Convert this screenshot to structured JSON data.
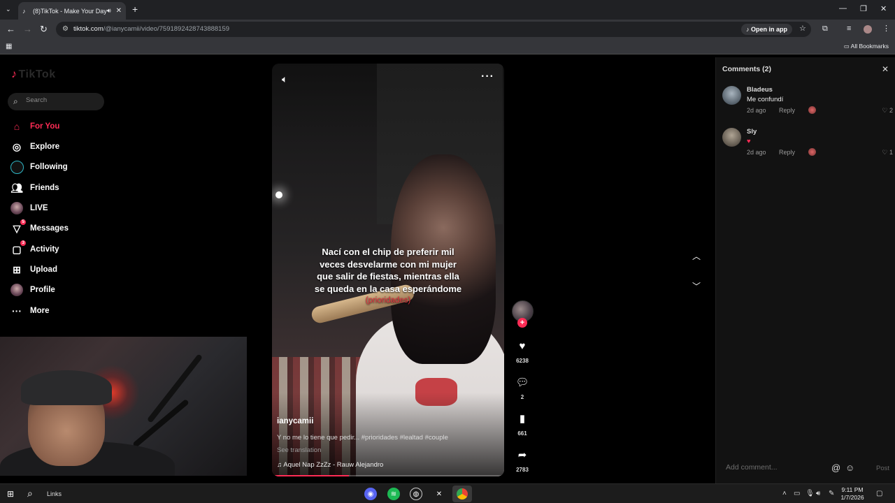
{
  "browser": {
    "tab_title": "(8)TikTok - Make Your Day",
    "url_host": "tiktok.com",
    "url_path": "/@ianycamii/video/7591892428743888159",
    "open_in_app": "Open in app",
    "all_bookmarks": "All Bookmarks"
  },
  "sidebar": {
    "logo": "TikTok",
    "search_placeholder": "Search",
    "items": [
      {
        "label": "For You",
        "icon": "home-icon"
      },
      {
        "label": "Explore",
        "icon": "compass-icon"
      },
      {
        "label": "Following",
        "icon": "following-avatar-icon"
      },
      {
        "label": "Friends",
        "icon": "friends-icon"
      },
      {
        "label": "LIVE",
        "icon": "live-avatar-icon"
      },
      {
        "label": "Messages",
        "icon": "messages-icon",
        "badge": "5"
      },
      {
        "label": "Activity",
        "icon": "activity-icon",
        "badge": "3"
      },
      {
        "label": "Upload",
        "icon": "upload-icon"
      },
      {
        "label": "Profile",
        "icon": "profile-avatar-icon"
      },
      {
        "label": "More",
        "icon": "more-icon"
      }
    ]
  },
  "video": {
    "caption_line1": "Nací con el chip de preferir mil",
    "caption_line2": "veces desvelarme con mi mujer",
    "caption_line3": "que salir de fiestas, mientras ella",
    "caption_line4": "se queda en la casa esperándome",
    "caption_tag": "(prioridades)",
    "username": "ianycamii",
    "description": "Y no me lo tiene que pedir... #prioridades #lealtad #couple",
    "see_translation": "See translation",
    "music": "Aquel Nap ZzZz - Rauw Alejandro",
    "progress_fraction": 0.33
  },
  "actions": {
    "likes": "6238",
    "comments": "2",
    "saves": "661",
    "shares": "2783"
  },
  "comments_panel": {
    "title": "Comments (2)",
    "items": [
      {
        "name": "Bladeus",
        "text": "Me confundí",
        "time": "2d ago",
        "reply": "Reply",
        "likes": "2"
      },
      {
        "name": "Sly",
        "text": "♥",
        "time": "2d ago",
        "reply": "Reply",
        "likes": "1"
      }
    ],
    "add_placeholder": "Add comment...",
    "post": "Post"
  },
  "taskbar": {
    "search_label": "Links",
    "time": "9:11 PM",
    "date": "1/7/2026"
  },
  "colors": {
    "accent": "#fe2c55",
    "background": "#000000"
  }
}
